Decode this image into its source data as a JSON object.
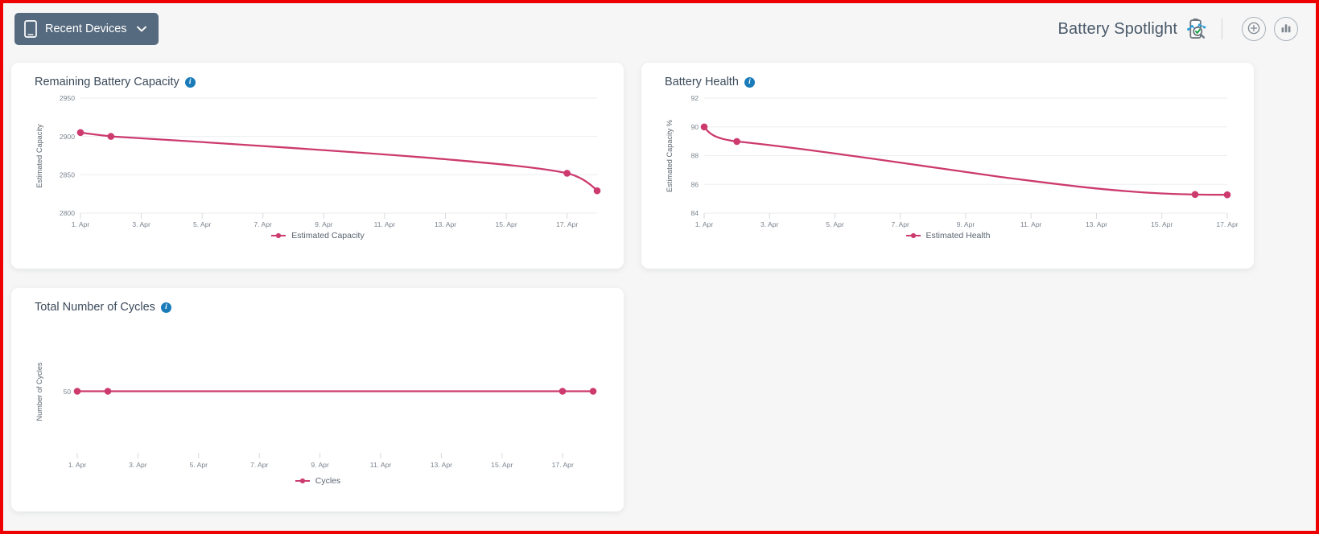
{
  "topbar": {
    "device_button_label": "Recent Devices",
    "device_icon": "tablet-icon",
    "chevron_icon": "chevron-down-icon",
    "app_title": "Battery Spotlight",
    "brand_icon": "battery-magnifier-icon",
    "add_button_icon": "add-circle-icon",
    "chart_button_icon": "bar-chart-icon",
    "button_bg": "#566a7f",
    "title_color": "#4a5a6a"
  },
  "theme": {
    "page_bg": "#f6f6f6",
    "card_bg": "#ffffff",
    "series_color": "#cc3a6e",
    "info_color": "#1a7bb9",
    "border_color": "#ee0000"
  },
  "cards": [
    {
      "title": "Remaining Battery Capacity",
      "info_icon": "info-icon"
    },
    {
      "title": "Battery Health",
      "info_icon": "info-icon"
    },
    {
      "title": "Total Number of Cycles",
      "info_icon": "info-icon"
    }
  ],
  "chart_data": [
    {
      "type": "line",
      "title": "Remaining Battery Capacity",
      "xlabel": "",
      "ylabel": "Estimated Capacity",
      "ylim": [
        2800,
        2950
      ],
      "yticks": [
        2800,
        2850,
        2900,
        2950
      ],
      "xticks": [
        "1. Apr",
        "3. Apr",
        "5. Apr",
        "7. Apr",
        "9. Apr",
        "11. Apr",
        "13. Apr",
        "15. Apr",
        "17. Apr"
      ],
      "xlim_days": [
        1,
        18
      ],
      "grid": true,
      "legend": "bottom-center",
      "series": [
        {
          "name": "Estimated Capacity",
          "color": "#cc3a6e",
          "x": [
            1,
            2,
            17,
            18
          ],
          "values": [
            2905,
            2900,
            2851,
            2822
          ],
          "marked_points": [
            1,
            2,
            17,
            18
          ]
        }
      ]
    },
    {
      "type": "line",
      "title": "Battery Health",
      "xlabel": "",
      "ylabel": "Estimated Capacity %",
      "ylim": [
        84,
        92
      ],
      "yticks": [
        84,
        86,
        88,
        90,
        92
      ],
      "xticks": [
        "1. Apr",
        "3. Apr",
        "5. Apr",
        "7. Apr",
        "9. Apr",
        "11. Apr",
        "13. Apr",
        "15. Apr",
        "17. Apr"
      ],
      "xlim_days": [
        1,
        18
      ],
      "grid": true,
      "legend": "bottom-center",
      "series": [
        {
          "name": "Estimated Health",
          "color": "#cc3a6e",
          "x": [
            1,
            2,
            17,
            18
          ],
          "values": [
            90.0,
            89.0,
            85.1,
            85.1
          ],
          "marked_points": [
            1,
            2,
            17,
            18
          ]
        }
      ]
    },
    {
      "type": "line",
      "title": "Total Number of Cycles",
      "xlabel": "",
      "ylabel": "Number of Cycles",
      "ylim": [
        45,
        57
      ],
      "yticks": [
        50
      ],
      "xticks": [
        "1. Apr",
        "3. Apr",
        "5. Apr",
        "7. Apr",
        "9. Apr",
        "11. Apr",
        "13. Apr",
        "15. Apr",
        "17. Apr"
      ],
      "xlim_days": [
        1,
        18
      ],
      "grid": false,
      "legend": "bottom-center",
      "series": [
        {
          "name": "Cycles",
          "color": "#cc3a6e",
          "x": [
            1,
            2,
            17,
            18
          ],
          "values": [
            50,
            50,
            50,
            50
          ],
          "marked_points": [
            1,
            2,
            17,
            18
          ]
        }
      ]
    }
  ]
}
